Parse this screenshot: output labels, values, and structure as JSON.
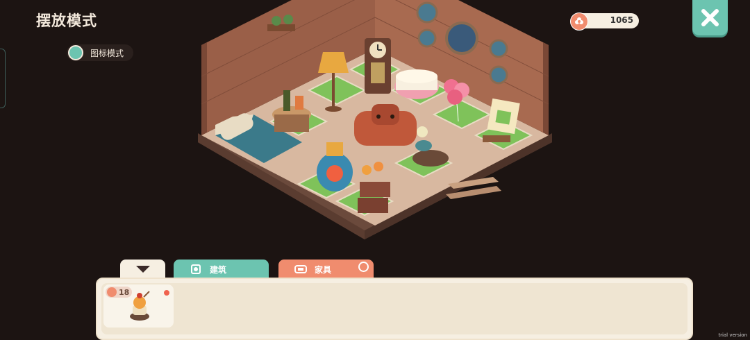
{
  "header": {
    "title": "摆放模式"
  },
  "mode_toggle": {
    "label": "图标模式"
  },
  "currency": {
    "value": "1065"
  },
  "tabs": {
    "build": {
      "label": "建筑"
    },
    "furniture": {
      "label": "家具"
    }
  },
  "inventory": {
    "items": [
      {
        "count": "18",
        "icon": "sundae-icon"
      }
    ]
  },
  "watermark": "trial version",
  "colors": {
    "accent_teal": "#6cc4b0",
    "accent_coral": "#f08c6e",
    "panel": "#f6efe2",
    "background": "#1c1412"
  }
}
